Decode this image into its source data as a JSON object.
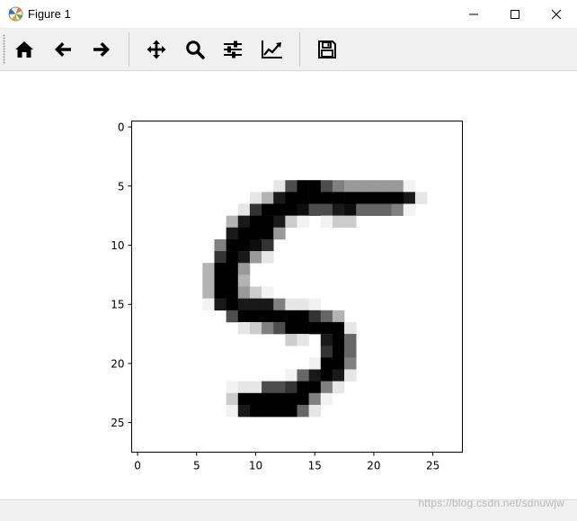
{
  "window": {
    "title": "Figure 1",
    "controls": [
      "minimize",
      "maximize",
      "close"
    ]
  },
  "toolbar": {
    "buttons": [
      {
        "name": "home",
        "icon": "home-icon"
      },
      {
        "name": "back",
        "icon": "arrow-left-icon"
      },
      {
        "name": "forward",
        "icon": "arrow-right-icon"
      },
      {
        "name": "pan",
        "icon": "move-icon"
      },
      {
        "name": "zoom",
        "icon": "zoom-icon"
      },
      {
        "name": "configure-subplots",
        "icon": "sliders-icon"
      },
      {
        "name": "edit-axis",
        "icon": "line-chart-icon"
      },
      {
        "name": "save",
        "icon": "floppy-disk-icon"
      }
    ]
  },
  "watermark": "https://blog.csdn.net/sdnuwjw",
  "chart_data": {
    "type": "heatmap",
    "colormap": "gray_r",
    "rows": 28,
    "cols": 28,
    "xticks": [
      0,
      5,
      10,
      15,
      20,
      25
    ],
    "yticks": [
      0,
      5,
      10,
      15,
      20,
      25
    ],
    "xlim": [
      -0.5,
      27.5
    ],
    "ylim": [
      27.5,
      -0.5
    ],
    "nonzero_pixels": {
      "5": [
        [
          12,
          0.1
        ],
        [
          13,
          0.7
        ],
        [
          14,
          1.0
        ],
        [
          15,
          1.0
        ],
        [
          16,
          0.7
        ],
        [
          17,
          0.5
        ],
        [
          18,
          0.4
        ],
        [
          19,
          0.4
        ],
        [
          20,
          0.4
        ],
        [
          21,
          0.4
        ],
        [
          22,
          0.4
        ],
        [
          23,
          0.05
        ]
      ],
      "6": [
        [
          10,
          0.1
        ],
        [
          11,
          0.3
        ],
        [
          12,
          0.9
        ],
        [
          13,
          1.0
        ],
        [
          14,
          1.0
        ],
        [
          15,
          1.0
        ],
        [
          16,
          1.0
        ],
        [
          17,
          1.0
        ],
        [
          18,
          1.0
        ],
        [
          19,
          1.0
        ],
        [
          20,
          1.0
        ],
        [
          21,
          1.0
        ],
        [
          22,
          1.0
        ],
        [
          23,
          0.9
        ],
        [
          24,
          0.1
        ]
      ],
      "7": [
        [
          9,
          0.1
        ],
        [
          10,
          0.8
        ],
        [
          11,
          1.0
        ],
        [
          12,
          1.0
        ],
        [
          13,
          1.0
        ],
        [
          14,
          0.95
        ],
        [
          15,
          0.7
        ],
        [
          16,
          0.7
        ],
        [
          17,
          0.9
        ],
        [
          18,
          0.95
        ],
        [
          19,
          0.6
        ],
        [
          20,
          0.6
        ],
        [
          21,
          0.6
        ],
        [
          22,
          0.5
        ],
        [
          23,
          0.05
        ]
      ],
      "8": [
        [
          8,
          0.3
        ],
        [
          9,
          0.9
        ],
        [
          10,
          1.0
        ],
        [
          11,
          1.0
        ],
        [
          12,
          0.9
        ],
        [
          13,
          0.2
        ],
        [
          14,
          0.05
        ],
        [
          16,
          0.05
        ],
        [
          17,
          0.2
        ],
        [
          18,
          0.2
        ]
      ],
      "9": [
        [
          8,
          0.9
        ],
        [
          9,
          1.0
        ],
        [
          10,
          1.0
        ],
        [
          11,
          1.0
        ],
        [
          12,
          0.4
        ]
      ],
      "10": [
        [
          7,
          0.5
        ],
        [
          8,
          1.0
        ],
        [
          9,
          1.0
        ],
        [
          10,
          0.95
        ],
        [
          11,
          0.8
        ]
      ],
      "11": [
        [
          7,
          0.8
        ],
        [
          8,
          1.0
        ],
        [
          9,
          0.9
        ],
        [
          10,
          0.4
        ],
        [
          11,
          0.1
        ]
      ],
      "12": [
        [
          6,
          0.3
        ],
        [
          7,
          1.0
        ],
        [
          8,
          1.0
        ],
        [
          9,
          0.4
        ]
      ],
      "13": [
        [
          6,
          0.3
        ],
        [
          7,
          1.0
        ],
        [
          8,
          1.0
        ],
        [
          9,
          0.3
        ]
      ],
      "14": [
        [
          6,
          0.3
        ],
        [
          7,
          1.0
        ],
        [
          8,
          1.0
        ],
        [
          9,
          0.4
        ],
        [
          10,
          0.2
        ],
        [
          11,
          0.05
        ]
      ],
      "15": [
        [
          6,
          0.05
        ],
        [
          7,
          0.9
        ],
        [
          8,
          1.0
        ],
        [
          9,
          0.9
        ],
        [
          10,
          0.9
        ],
        [
          11,
          0.9
        ],
        [
          12,
          0.5
        ],
        [
          13,
          0.1
        ],
        [
          14,
          0.1
        ],
        [
          15,
          0.05
        ]
      ],
      "16": [
        [
          8,
          0.7
        ],
        [
          9,
          1.0
        ],
        [
          10,
          1.0
        ],
        [
          11,
          1.0
        ],
        [
          12,
          1.0
        ],
        [
          13,
          1.0
        ],
        [
          14,
          1.0
        ],
        [
          15,
          0.8
        ],
        [
          16,
          0.6
        ],
        [
          17,
          0.3
        ]
      ],
      "17": [
        [
          9,
          0.1
        ],
        [
          10,
          0.2
        ],
        [
          11,
          0.5
        ],
        [
          12,
          0.7
        ],
        [
          13,
          1.0
        ],
        [
          14,
          1.0
        ],
        [
          15,
          1.0
        ],
        [
          16,
          1.0
        ],
        [
          17,
          1.0
        ],
        [
          18,
          0.1
        ]
      ],
      "18": [
        [
          13,
          0.2
        ],
        [
          14,
          0.1
        ],
        [
          16,
          0.9
        ],
        [
          17,
          1.0
        ],
        [
          18,
          0.6
        ]
      ],
      "19": [
        [
          16,
          0.8
        ],
        [
          17,
          1.0
        ],
        [
          18,
          0.6
        ]
      ],
      "20": [
        [
          15,
          0.05
        ],
        [
          16,
          1.0
        ],
        [
          17,
          1.0
        ],
        [
          18,
          0.5
        ]
      ],
      "21": [
        [
          13,
          0.05
        ],
        [
          14,
          0.6
        ],
        [
          15,
          0.9
        ],
        [
          16,
          1.0
        ],
        [
          17,
          0.9
        ],
        [
          18,
          0.1
        ]
      ],
      "22": [
        [
          8,
          0.05
        ],
        [
          9,
          0.1
        ],
        [
          10,
          0.1
        ],
        [
          11,
          0.7
        ],
        [
          12,
          0.7
        ],
        [
          13,
          0.8
        ],
        [
          14,
          1.0
        ],
        [
          15,
          1.0
        ],
        [
          16,
          0.5
        ],
        [
          17,
          0.1
        ]
      ],
      "23": [
        [
          8,
          0.2
        ],
        [
          9,
          1.0
        ],
        [
          10,
          1.0
        ],
        [
          11,
          1.0
        ],
        [
          12,
          1.0
        ],
        [
          13,
          1.0
        ],
        [
          14,
          1.0
        ],
        [
          15,
          0.5
        ],
        [
          16,
          0.05
        ]
      ],
      "24": [
        [
          8,
          0.05
        ],
        [
          9,
          0.9
        ],
        [
          10,
          1.0
        ],
        [
          11,
          1.0
        ],
        [
          12,
          1.0
        ],
        [
          13,
          1.0
        ],
        [
          14,
          0.6
        ],
        [
          15,
          0.1
        ]
      ]
    }
  }
}
